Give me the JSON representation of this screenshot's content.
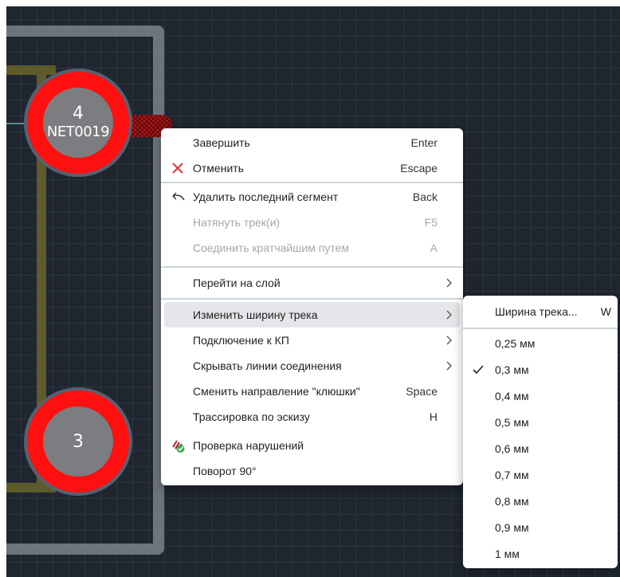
{
  "pads": [
    {
      "number": "4",
      "net": "NET0019"
    },
    {
      "number": "3",
      "net": ""
    }
  ],
  "context_menu": {
    "items": [
      {
        "label": "Завершить",
        "shortcut": "Enter",
        "icon": "",
        "disabled": false,
        "submenu": false
      },
      {
        "label": "Отменить",
        "shortcut": "Escape",
        "icon": "close-icon",
        "disabled": false,
        "submenu": false
      },
      {
        "label": "Удалить последний сегмент",
        "shortcut": "Back",
        "icon": "undo-arrow-icon",
        "disabled": false,
        "submenu": false
      },
      {
        "label": "Натянуть трек(и)",
        "shortcut": "F5",
        "icon": "",
        "disabled": true,
        "submenu": false
      },
      {
        "label": "Соединить кратчайшим путем",
        "shortcut": "A",
        "icon": "",
        "disabled": true,
        "submenu": false
      },
      {
        "label": "Перейти на слой",
        "shortcut": "",
        "icon": "",
        "disabled": false,
        "submenu": true
      },
      {
        "label": "Изменить ширину трека",
        "shortcut": "",
        "icon": "",
        "disabled": false,
        "submenu": true,
        "highlighted": true
      },
      {
        "label": "Подключение к КП",
        "shortcut": "",
        "icon": "",
        "disabled": false,
        "submenu": true
      },
      {
        "label": "Скрывать линии соединения",
        "shortcut": "",
        "icon": "",
        "disabled": false,
        "submenu": true
      },
      {
        "label": "Сменить направление \"клюшки\"",
        "shortcut": "Space",
        "icon": "",
        "disabled": false,
        "submenu": false
      },
      {
        "label": "Трассировка по эскизу",
        "shortcut": "H",
        "icon": "",
        "disabled": false,
        "submenu": false
      },
      {
        "label": "Проверка нарушений",
        "shortcut": "",
        "icon": "drc-check-icon",
        "disabled": false,
        "submenu": false
      },
      {
        "label": "Поворот 90°",
        "shortcut": "",
        "icon": "",
        "disabled": false,
        "submenu": false
      }
    ]
  },
  "width_submenu": {
    "header": "Ширина трека...",
    "header_shortcut": "W",
    "options": [
      "0,25 мм",
      "0,3 мм",
      "0,4 мм",
      "0,5 мм",
      "0,6 мм",
      "0,7 мм",
      "0,8 мм",
      "0,9 мм",
      "1 мм"
    ],
    "selected": "0,3 мм"
  },
  "colors": {
    "canvas": "#1f2630",
    "pad": "#ff1010",
    "pad_center": "#7b7d80",
    "highlight": "#e4e6e9",
    "delete_icon": "#e0383a"
  }
}
